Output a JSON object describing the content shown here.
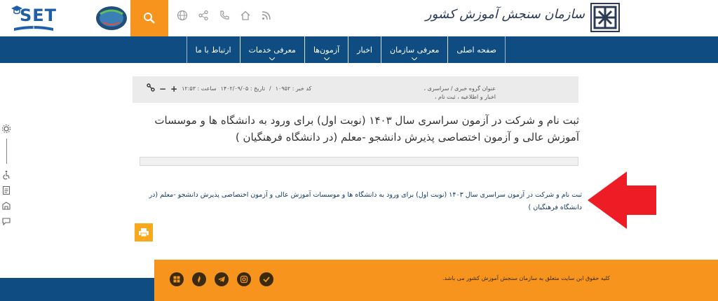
{
  "header": {
    "set_logo_text": "SET",
    "org_name": "سازمان سنجش آموزش کشور",
    "icons": [
      "rss-icon",
      "home-icon",
      "phone-icon",
      "share-icon",
      "globe-icon"
    ],
    "search_icon": "search-icon"
  },
  "nav": {
    "items": [
      {
        "label": "صفحه اصلی",
        "has_caret": false
      },
      {
        "label": "معرفی سازمان",
        "has_caret": true
      },
      {
        "label": "اخبار",
        "has_caret": false
      },
      {
        "label": "آزمون‌ها",
        "has_caret": true
      },
      {
        "label": "معرفی خدمات",
        "has_caret": true
      },
      {
        "label": "ارتباط با ما",
        "has_caret": false
      }
    ]
  },
  "meta": {
    "group_line1": "عنوان گروه خبری / سراسری ،",
    "group_line2": "اخبار و اطلاعیه ، ثبت نام ،",
    "news_code": "کد خبر : ۱۰۹۵۲",
    "date": "تاریخ : ۱۴۰۲/۰۹/۰۵",
    "time": "ساعت : ۱۲:۵۳",
    "zoom_in": "+",
    "zoom_out": "−"
  },
  "article": {
    "title": "ثبت نام و شرکت در آزمون سراسری سال ۱۴۰۳ (نوبت اول) برای ورود به دانشگاه ها و موسسات آموزش عالی و آزمون اختصاصی پذیرش دانشجو -معلم (در دانشگاه فرهنگیان )",
    "link_text": "ثبت نام و شرکت در آزمون سراسری سال ۱۴۰۳ (نوبت اول) برای ورود به دانشگاه ها و موسسات آموزش عالی و آزمون اختصاصی پذیرش دانشجو -معلم (در دانشگاه فرهنگیان )"
  },
  "footer": {
    "copyright": "کلیه حقوق این سایت متعلق به سازمان سنجش آموزش کشور می باشد.",
    "socials": [
      "aparat-icon",
      "soroush-icon",
      "telegram-icon",
      "instagram-icon",
      "eitaa-icon"
    ]
  },
  "colors": {
    "orange": "#f7941d",
    "navy": "#0f4c81",
    "arrow_red": "#ee1c25"
  }
}
